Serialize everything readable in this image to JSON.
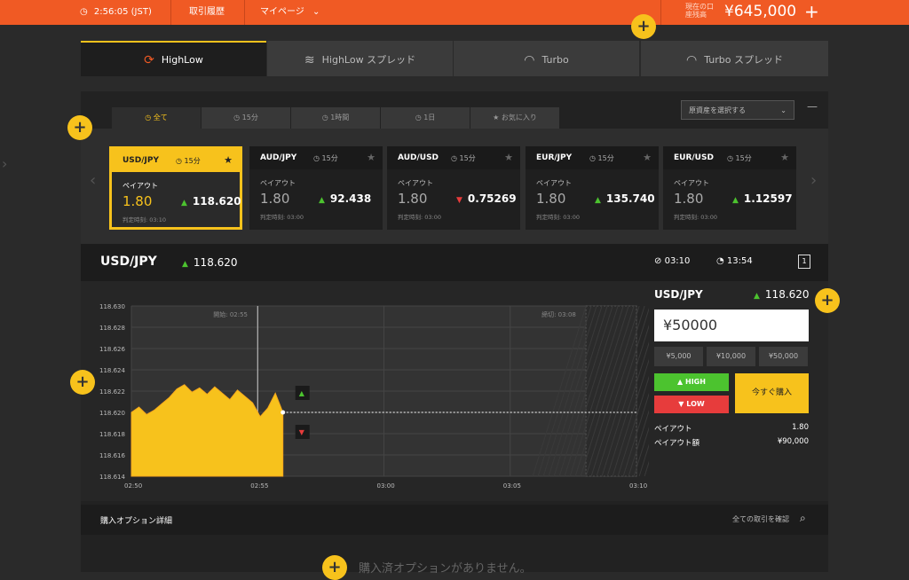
{
  "topbar": {
    "time": "2:56:05 (JST)",
    "history": "取引履歴",
    "mypage": "マイページ",
    "balance_label": "現在の口座残高",
    "balance": "¥645,000",
    "plus": "+"
  },
  "product_tabs": [
    {
      "label": "HighLow",
      "icon": "highlow-icon",
      "active": true
    },
    {
      "label": "HighLow スプレッド",
      "icon": "spread-icon",
      "active": false
    },
    {
      "label": "Turbo",
      "icon": "speedometer-icon",
      "active": false
    },
    {
      "label": "Turbo スプレッド",
      "icon": "speedometer-dashed-icon",
      "active": false
    }
  ],
  "filter_tabs": [
    {
      "label": "全て",
      "active": true
    },
    {
      "label": "15分",
      "active": false
    },
    {
      "label": "1時間",
      "active": false
    },
    {
      "label": "1日",
      "active": false
    },
    {
      "label": "お気に入り",
      "active": false
    }
  ],
  "asset_select": {
    "placeholder": "原資産を選択する"
  },
  "cards": [
    {
      "pair": "USD/JPY",
      "duration": "15分",
      "payout_label": "ペイアウト",
      "payout": "1.80",
      "direction": "up",
      "rate": "118.620",
      "expiry": "判定時刻: 03:10",
      "active": true
    },
    {
      "pair": "AUD/JPY",
      "duration": "15分",
      "payout_label": "ペイアウト",
      "payout": "1.80",
      "direction": "up",
      "rate": "92.438",
      "expiry": "判定時刻: 03:00",
      "active": false
    },
    {
      "pair": "AUD/USD",
      "duration": "15分",
      "payout_label": "ペイアウト",
      "payout": "1.80",
      "direction": "down",
      "rate": "0.75269",
      "expiry": "判定時刻: 03:00",
      "active": false
    },
    {
      "pair": "EUR/JPY",
      "duration": "15分",
      "payout_label": "ペイアウト",
      "payout": "1.80",
      "direction": "up",
      "rate": "135.740",
      "expiry": "判定時刻: 03:00",
      "active": false
    },
    {
      "pair": "EUR/USD",
      "duration": "15分",
      "payout_label": "ペイアウト",
      "payout": "1.80",
      "direction": "up",
      "rate": "1.12597",
      "expiry": "判定時刻: 03:00",
      "active": false
    }
  ],
  "selected": {
    "pair": "USD/JPY",
    "rate": "118.620",
    "expiry": "03:10",
    "time_left": "13:54"
  },
  "chart_data": {
    "type": "area",
    "start_label": "開始: 02:55",
    "end_label": "締切: 03:08",
    "x_ticks": [
      "02:50",
      "02:55",
      "03:00",
      "03:05",
      "03:10"
    ],
    "y_ticks": [
      "118.630",
      "118.628",
      "118.626",
      "118.624",
      "118.622",
      "118.620",
      "118.618",
      "118.616",
      "118.614"
    ],
    "ylim": [
      118.614,
      118.63
    ],
    "x_minutes": [
      0,
      0.3,
      0.6,
      0.9,
      1.2,
      1.5,
      1.8,
      2.1,
      2.4,
      2.7,
      3.0,
      3.3,
      3.6,
      3.9,
      4.2,
      4.5,
      4.8,
      5.1,
      5.4,
      5.7,
      6.0
    ],
    "values": [
      118.62,
      118.6205,
      118.6198,
      118.6202,
      118.6208,
      118.6214,
      118.6222,
      118.6226,
      118.6219,
      118.6223,
      118.6217,
      118.6224,
      118.6218,
      118.6212,
      118.6221,
      118.6215,
      118.6209,
      118.6196,
      118.6204,
      118.6218,
      118.62
    ],
    "current": 118.62
  },
  "trade": {
    "pair": "USD/JPY",
    "rate": "118.620",
    "amount": "¥50000",
    "presets": [
      "¥5,000",
      "¥10,000",
      "¥50,000"
    ],
    "high_label": "HIGH",
    "low_label": "LOW",
    "buy_label": "今すぐ購入",
    "payout_label": "ペイアウト",
    "payout_value": "1.80",
    "payout_amount_label": "ペイアウト額",
    "payout_amount_value": "¥90,000"
  },
  "options": {
    "title": "購入オプション詳細",
    "link": "全ての取引を確認",
    "empty": "購入済オプションがありません。"
  },
  "colors": {
    "accent": "#f7c21c",
    "header": "#f05a24",
    "up": "#4cc32f",
    "down": "#e73c3c"
  }
}
